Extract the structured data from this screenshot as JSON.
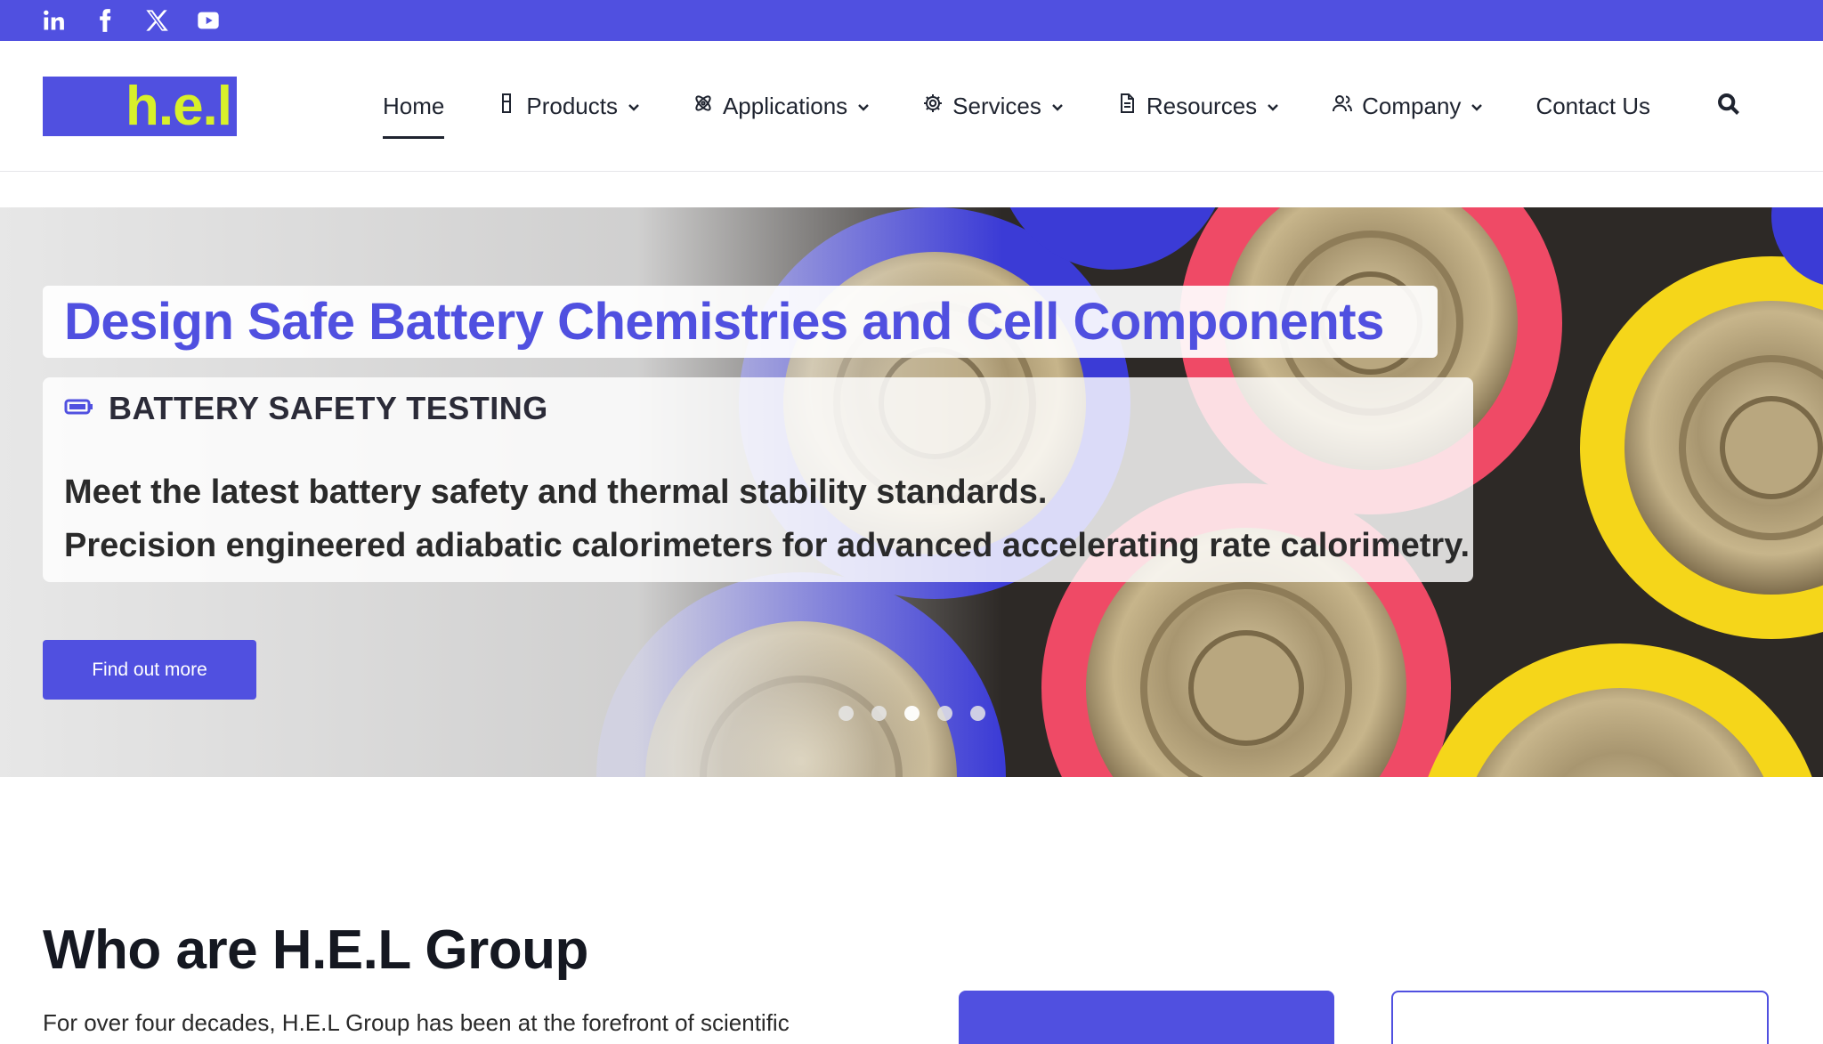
{
  "social": [
    {
      "name": "linkedin-icon",
      "label": "in"
    },
    {
      "name": "facebook-icon",
      "label": "f"
    },
    {
      "name": "x-icon",
      "label": "X"
    },
    {
      "name": "youtube-icon",
      "label": "YouTube"
    }
  ],
  "logo": {
    "text": "h.e.l"
  },
  "nav": {
    "home": "Home",
    "products": "Products",
    "applications": "Applications",
    "services": "Services",
    "resources": "Resources",
    "company": "Company",
    "contact": "Contact Us"
  },
  "hero": {
    "title": "Design Safe Battery Chemistries and Cell Components",
    "tag": "BATTERY SAFETY TESTING",
    "line1": "Meet the latest battery safety and thermal stability standards.",
    "line2": "Precision engineered adiabatic calorimeters for advanced accelerating rate calorimetry.",
    "button": "Find out more",
    "slides_total": 5,
    "active_slide": 3
  },
  "who": {
    "title": "Who are H.E.L Group",
    "text": "For over four decades, H.E.L Group has been at the forefront of scientific"
  },
  "colors": {
    "brand": "#5050e0",
    "logo_text": "#d8f02a",
    "battery_blue": "#3b3bd6",
    "battery_red": "#ef4a66",
    "battery_yellow": "#f5d61a"
  }
}
